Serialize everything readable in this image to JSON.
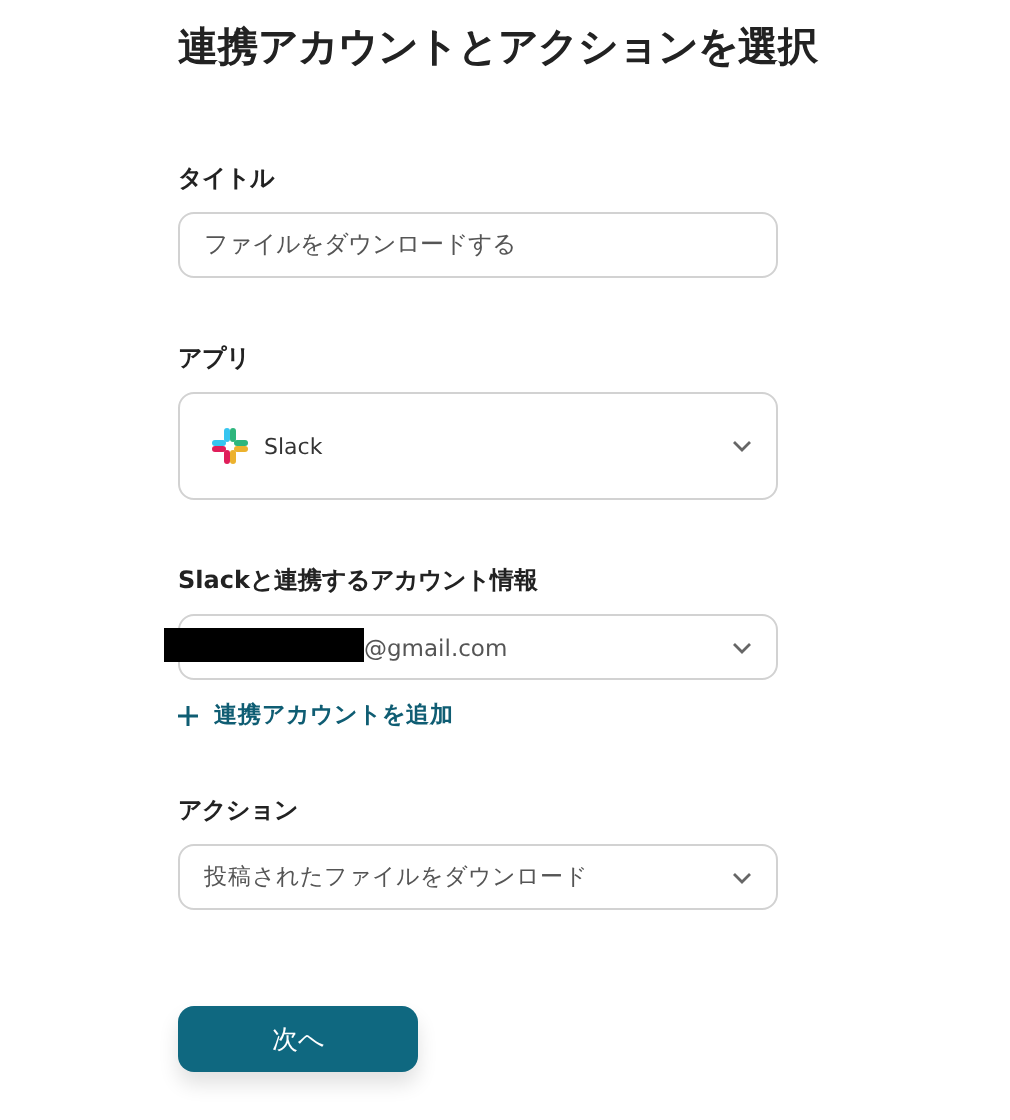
{
  "heading": "連携アカウントとアクションを選択",
  "fields": [
    {
      "kind": "text",
      "label": "タイトル",
      "value": "ファイルをダウンロードする"
    },
    {
      "kind": "app",
      "label": "アプリ",
      "value": "Slack"
    },
    {
      "kind": "account",
      "label": "Slackと連携するアカウント情報",
      "value": "@gmail.com",
      "redacted": true,
      "add_link": "連携アカウントを追加"
    },
    {
      "kind": "select",
      "label": "アクション",
      "value": "投稿されたファイルをダウンロード"
    }
  ],
  "next_button": "次へ"
}
